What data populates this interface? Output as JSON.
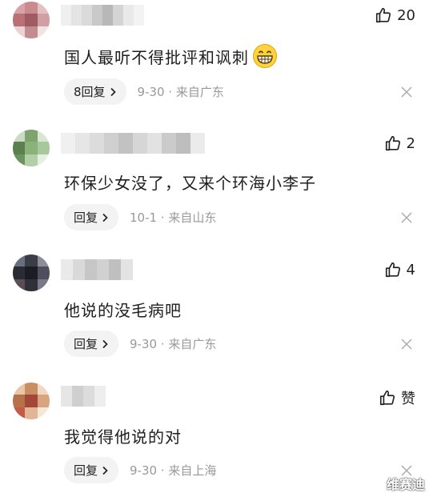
{
  "comments": [
    {
      "text": "国人最听不得批评和讽刺",
      "likes": "20",
      "reply_label": "8回复",
      "date": "9-30",
      "location": "来自广东",
      "emoji": "grinning-face-emoji"
    },
    {
      "text": "环保少女没了，又来个环海小李子",
      "likes": "2",
      "reply_label": "回复",
      "date": "10-1",
      "location": "来自山东"
    },
    {
      "text": "他说的没毛病吧",
      "likes": "4",
      "reply_label": "回复",
      "date": "9-30",
      "location": "来自广东"
    },
    {
      "text": "我觉得他说的对",
      "likes": "赞",
      "reply_label": "回复",
      "date": "9-30",
      "location": "来自上海"
    }
  ],
  "separator": " · ",
  "watermark": "维赛迪",
  "icons": {
    "like": "thumbs-up-icon",
    "close": "close-icon",
    "chevron": "chevron-right-icon"
  },
  "colors": {
    "text": "#1e1e1e",
    "meta": "#999999",
    "reply_bg": "#f3f3f3"
  }
}
